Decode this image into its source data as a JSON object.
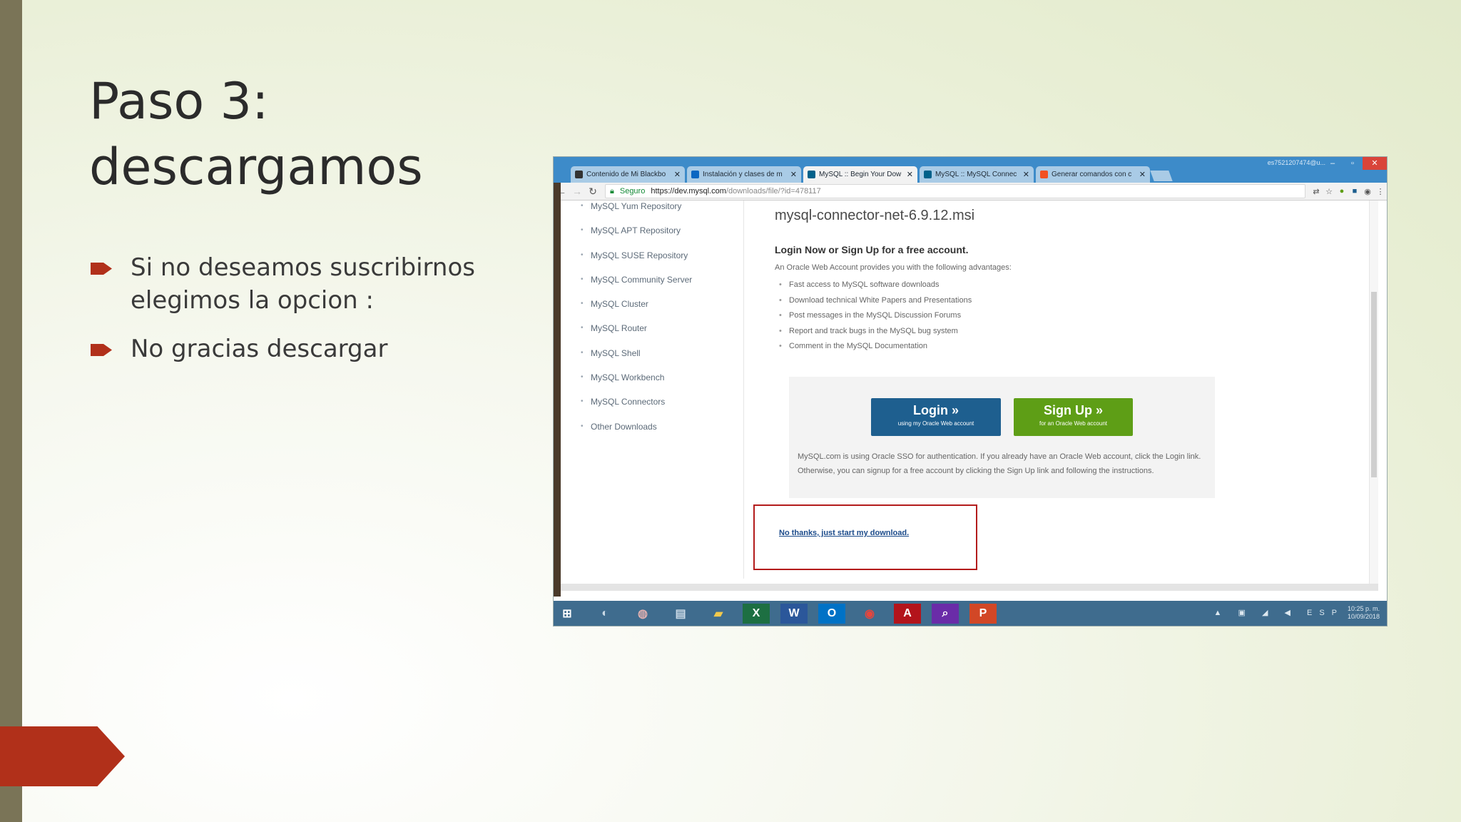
{
  "slide": {
    "title_line1": "Paso 3:",
    "title_line2": "descargamos",
    "bullets": [
      "Si no deseamos suscribirnos elegimos la opcion :",
      "No gracias descargar"
    ],
    "accent_color": "#b1301a"
  },
  "browser": {
    "window_user": "es752120747​4@u...",
    "tabs": [
      {
        "label": "Contenido de Mi Blackbo",
        "icon": "blackboard-icon"
      },
      {
        "label": "Instalación y clases de m",
        "icon": "linkedin-icon"
      },
      {
        "label": "MySQL :: Begin Your Dow",
        "icon": "mysql-icon"
      },
      {
        "label": "MySQL :: MySQL Connec",
        "icon": "mysql-icon"
      },
      {
        "label": "Generar comandos con c",
        "icon": "microsoft-icon"
      }
    ],
    "secure_label": "Seguro",
    "url_host": "https://dev.mysql.com",
    "url_path": "/downloads/file/?id=478117"
  },
  "sidenav": [
    "MySQL Yum Repository",
    "MySQL APT Repository",
    "MySQL SUSE Repository",
    "MySQL Community Server",
    "MySQL Cluster",
    "MySQL Router",
    "MySQL Shell",
    "MySQL Workbench",
    "MySQL Connectors",
    "Other Downloads"
  ],
  "content": {
    "file_name": "mysql-connector-net-6.9.12.msi",
    "login_heading": "Login Now or Sign Up for a free account.",
    "oracle_note": "An Oracle Web Account provides you with the following advantages:",
    "advantages": [
      "Fast access to MySQL software downloads",
      "Download technical White Papers and Presentations",
      "Post messages in the MySQL Discussion Forums",
      "Report and track bugs in the MySQL bug system",
      "Comment in the MySQL Documentation"
    ],
    "login_label": "Login »",
    "login_sub": "using my Oracle Web account",
    "signup_label": "Sign Up »",
    "signup_sub": "for an Oracle Web account",
    "sso_text": "MySQL.com is using Oracle SSO for authentication. If you already have an Oracle Web account, click the Login link. Otherwise, you can signup for a free account by clicking the Sign Up link and following the instructions.",
    "no_thanks": "No thanks, just start my download."
  },
  "taskbar": {
    "time": "10:25 p. m.",
    "date": "10/09/2018",
    "lang": "ESP"
  }
}
